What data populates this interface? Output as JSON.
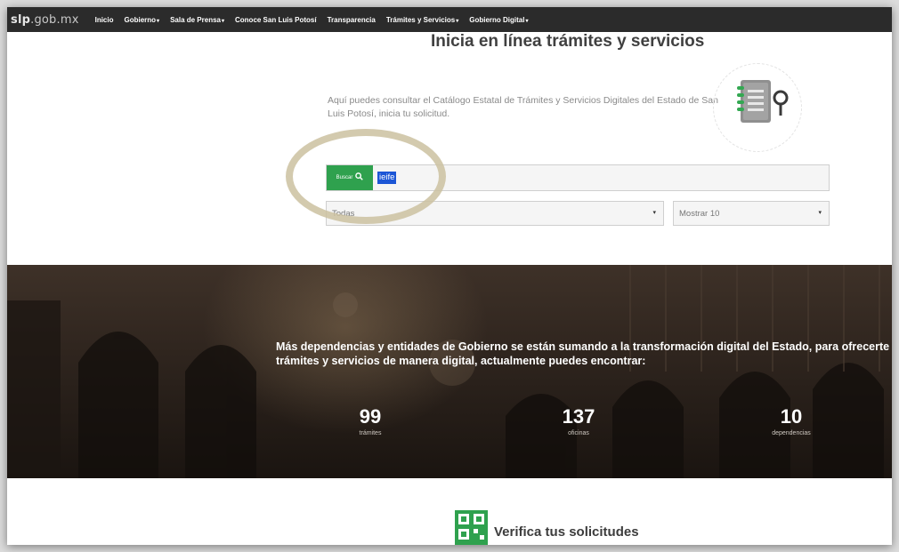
{
  "nav": {
    "logo_bold": "slp",
    "logo_rest": ".gob.mx",
    "items": [
      {
        "label": "Inicio",
        "dropdown": false
      },
      {
        "label": "Gobierno",
        "dropdown": true
      },
      {
        "label": "Sala de Prensa",
        "dropdown": true
      },
      {
        "label": "Conoce San Luis Potosí",
        "dropdown": false
      },
      {
        "label": "Transparencia",
        "dropdown": false
      },
      {
        "label": "Trámites y Servicios",
        "dropdown": true
      },
      {
        "label": "Gobierno Digital",
        "dropdown": true
      }
    ],
    "caret": "▾"
  },
  "header": {
    "title": "Inicia en línea trámites y servicios",
    "intro": "Aquí puedes consultar el Catálogo Estatal de Trámites y Servicios Digitales del Estado de San Luis Potosí, inicia tu solicitud."
  },
  "search": {
    "button_label": "Buscar",
    "button_icon": "🔍",
    "input_value": "ieife",
    "category_select": "Todas",
    "show_select": "Mostrar 10",
    "select_arrow": "▾"
  },
  "hero": {
    "text": "Más dependencias y entidades de Gobierno se están sumando a la transformación digital del Estado, para ofrecerte trámites y servicios de manera digital, actualmente puedes encontrar:",
    "stats": [
      {
        "value": "99",
        "label": "trámites"
      },
      {
        "value": "137",
        "label": "oficinas"
      },
      {
        "value": "10",
        "label": "dependencias"
      }
    ]
  },
  "verify": {
    "title": "Verifica tus solicitudes"
  },
  "colors": {
    "navbar": "#2b2b2b",
    "accent_green": "#2fa14e",
    "hero_dark": "#2a211b",
    "highlight_ring": "#cbc1a0"
  }
}
